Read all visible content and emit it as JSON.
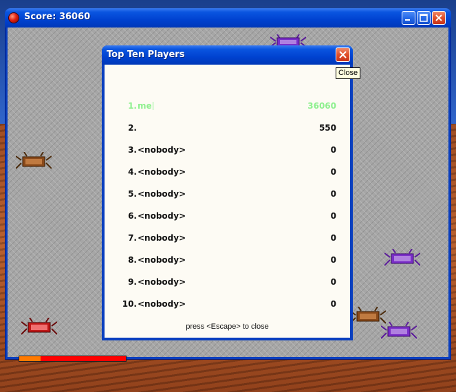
{
  "window": {
    "title": "Score: 36060"
  },
  "dialog": {
    "title": "Top Ten Players",
    "close_tooltip": "Close",
    "footer": "press <Escape> to close",
    "rows": [
      {
        "rank": "1.",
        "name": "me",
        "score": "36060",
        "highlight": true
      },
      {
        "rank": "2.",
        "name": "",
        "score": "550"
      },
      {
        "rank": "3.",
        "name": "<nobody>",
        "score": "0"
      },
      {
        "rank": "4.",
        "name": "<nobody>",
        "score": "0"
      },
      {
        "rank": "5.",
        "name": "<nobody>",
        "score": "0"
      },
      {
        "rank": "6.",
        "name": "<nobody>",
        "score": "0"
      },
      {
        "rank": "7.",
        "name": "<nobody>",
        "score": "0"
      },
      {
        "rank": "8.",
        "name": "<nobody>",
        "score": "0"
      },
      {
        "rank": "9.",
        "name": "<nobody>",
        "score": "0"
      },
      {
        "rank": "10.",
        "name": "<nobody>",
        "score": "0"
      }
    ]
  },
  "player": {
    "health_fraction": 0.2
  },
  "colors": {
    "title_bar": "#0042d0",
    "highlight_row": "#8ff08f",
    "health_bar": "#ff0000",
    "health_fill": "#ff7a00",
    "enemy_purple": "#7a2ec8",
    "enemy_brown": "#8a4a1a",
    "enemy_red": "#c01818"
  }
}
